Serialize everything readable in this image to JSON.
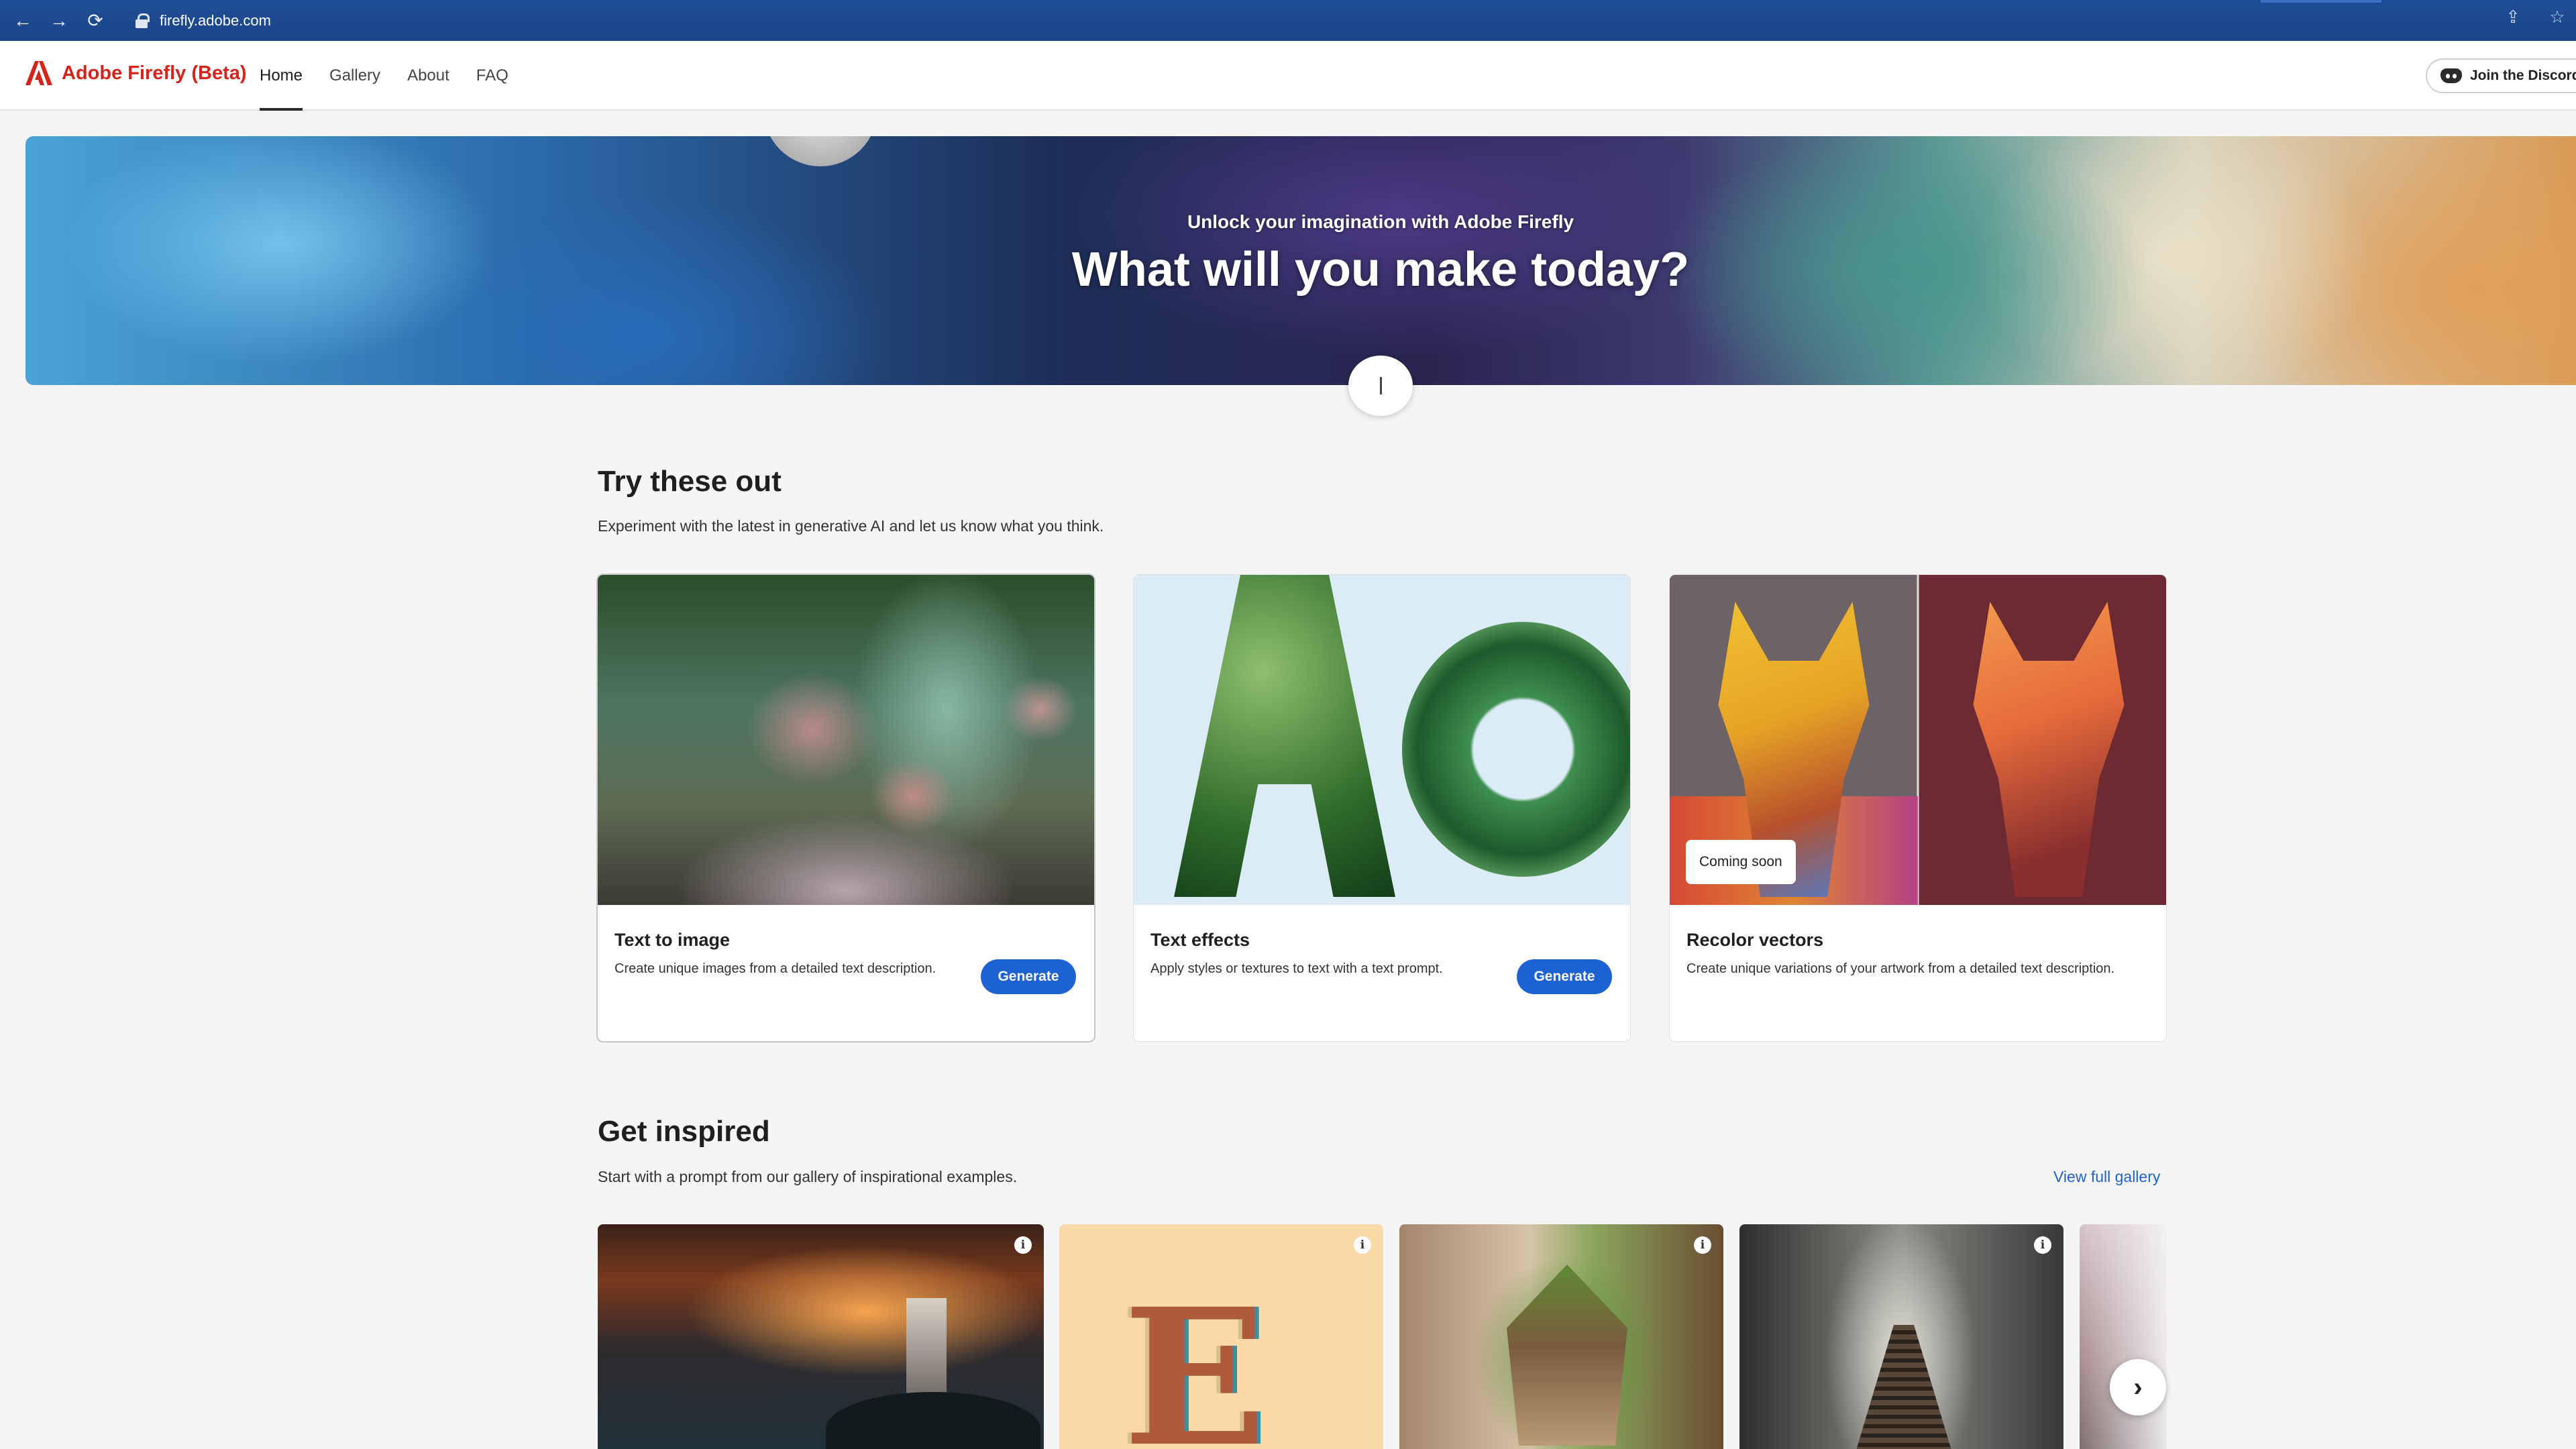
{
  "browser": {
    "url": "firefly.adobe.com",
    "back_icon": "←",
    "forward_icon": "→",
    "reload_icon": "⟳",
    "share_icon": "⇪",
    "star_icon": "☆"
  },
  "header": {
    "app_title": "Adobe Firefly (Beta)",
    "nav": [
      "Home",
      "Gallery",
      "About",
      "FAQ"
    ],
    "active_nav": "Home",
    "discord_label": "Join the Discord"
  },
  "hero": {
    "subtitle": "Unlock your imagination with Adobe Firefly",
    "headline": "What will you make today?"
  },
  "try_section": {
    "title": "Try these out",
    "description": "Experiment with the latest in generative AI and let us know what you think.",
    "cards": [
      {
        "name": "Text to image",
        "description": "Create unique images from a detailed text description.",
        "button": "Generate"
      },
      {
        "name": "Text effects",
        "description": "Apply styles or textures to text with a text prompt.",
        "button": "Generate"
      },
      {
        "name": "Recolor vectors",
        "description": "Create unique variations of your artwork from a detailed text description.",
        "badge": "Coming soon"
      }
    ]
  },
  "inspired_section": {
    "title": "Get inspired",
    "description": "Start with a prompt from our gallery of inspirational examples.",
    "view_gallery_link": "View full gallery",
    "tile_letter": "E",
    "info_glyph": "i",
    "next_glyph": "›"
  },
  "colors": {
    "brand_red": "#d7231a",
    "accent_blue": "#1d62d3",
    "chrome_blue": "#1f4d95"
  }
}
